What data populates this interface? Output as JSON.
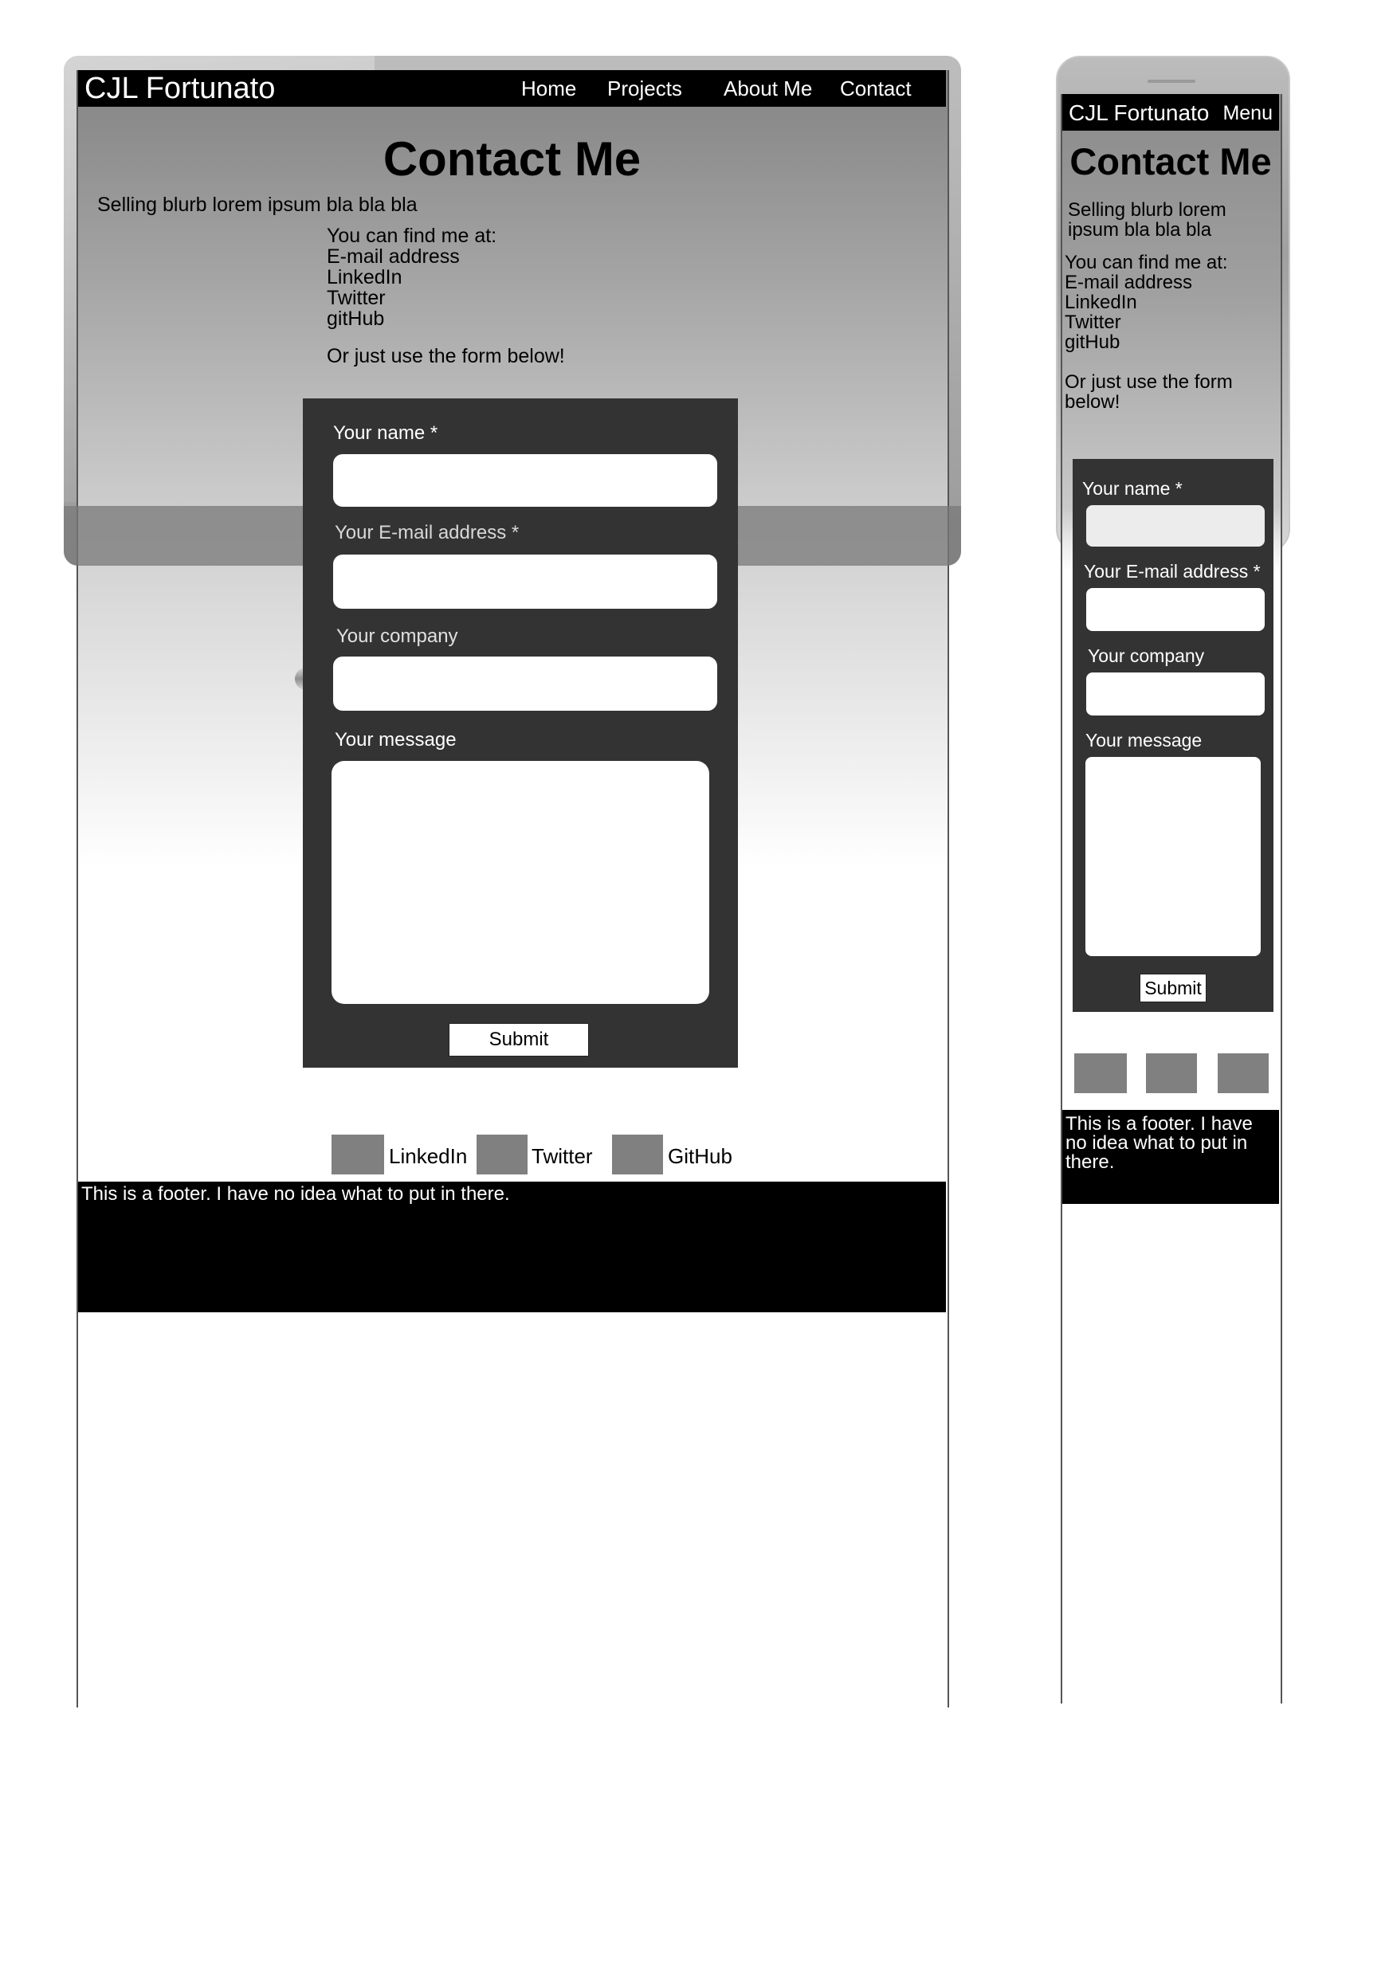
{
  "desktop": {
    "brand": "CJL Fortunato",
    "nav": [
      "Home",
      "Projects",
      "About Me",
      "Contact"
    ],
    "title": "Contact Me",
    "blurb": "Selling blurb lorem ipsum bla bla bla",
    "find_me_heading": "You can find me at:",
    "find_me_items": [
      "E-mail address",
      "LinkedIn",
      "Twitter",
      "gitHub"
    ],
    "form_note": "Or just use the form below!",
    "form": {
      "name_label": "Your name *",
      "email_label": "Your E-mail address *",
      "company_label": "Your company",
      "message_label": "Your message",
      "submit_label": "Submit"
    },
    "social": [
      "LinkedIn",
      "Twitter",
      "GitHub"
    ],
    "footer": "This is a footer. I have no idea what to put in there."
  },
  "mobile": {
    "brand": "CJL Fortunato",
    "menu_label": "Menu",
    "title": "Contact Me",
    "blurb": "Selling blurb lorem ipsum bla bla bla",
    "find_me_heading": "You can find me at:",
    "find_me_items": [
      "E-mail address",
      "LinkedIn",
      "Twitter",
      "gitHub"
    ],
    "form_note": "Or just use the form below!",
    "form": {
      "name_label": "Your name *",
      "email_label": "Your E-mail address *",
      "company_label": "Your company",
      "message_label": "Your message",
      "submit_label": "Submit"
    },
    "footer": "This is a footer. I have no idea what to put in there."
  },
  "colors": {
    "nav_bg": "#000000",
    "form_panel_bg": "#333333",
    "social_icon_bg": "#808080",
    "footer_bg": "#000000"
  }
}
